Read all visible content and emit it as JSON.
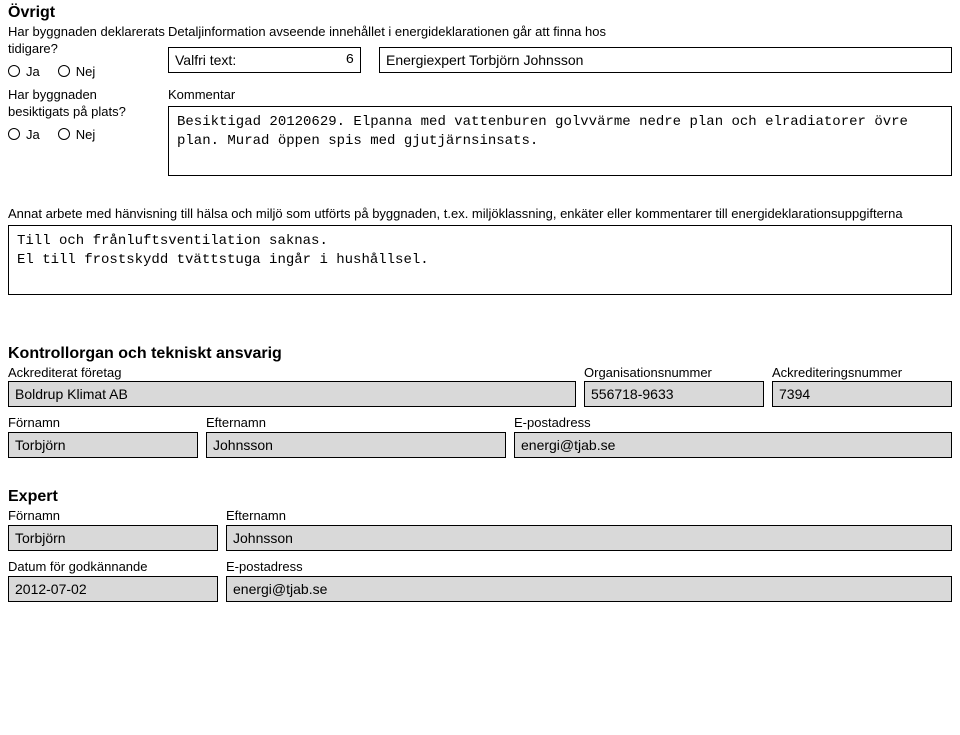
{
  "ovrigt": {
    "title": "Övrigt",
    "q1": "Har byggnaden deklarerats tidigare?",
    "q2_a": "Har byggnaden",
    "q2_b": "besiktigats på plats?",
    "ja": "Ja",
    "nej": "Nej",
    "detail_info": "Detaljinformation avseende innehållet i energideklarationen går att finna hos",
    "valfri_label": "Valfri text:",
    "valfri_num": "6",
    "valfri_value": "Energiexpert Torbjörn Johnsson",
    "kommentar_label": "Kommentar",
    "kommentar_text": "Besiktigad 20120629. Elpanna med vattenburen golvvärme nedre plan och elradiatorer övre plan. Murad öppen spis med gjutjärnsinsats."
  },
  "annat": {
    "label": "Annat arbete med hänvisning till hälsa och miljö som utförts på byggnaden, t.ex. miljöklassning, enkäter eller kommentarer till energideklarationsuppgifterna",
    "text": "Till och frånluftsventilation saknas.\nEl till frostskydd tvättstuga ingår i hushållsel."
  },
  "kontroll": {
    "title": "Kontrollorgan och tekniskt ansvarig",
    "ack_foretag_label": "Ackrediterat företag",
    "ack_foretag": "Boldrup Klimat AB",
    "orgnr_label": "Organisationsnummer",
    "orgnr": "556718-9633",
    "acknr_label": "Ackrediteringsnummer",
    "acknr": "7394",
    "fornamn_label": "Förnamn",
    "fornamn": "Torbjörn",
    "efternamn_label": "Efternamn",
    "efternamn": "Johnsson",
    "epost_label": "E-postadress",
    "epost": "energi@tjab.se"
  },
  "expert": {
    "title": "Expert",
    "fornamn_label": "Förnamn",
    "fornamn": "Torbjörn",
    "efternamn_label": "Efternamn",
    "efternamn": "Johnsson",
    "datum_label": "Datum för godkännande",
    "datum": "2012-07-02",
    "epost_label": "E-postadress",
    "epost": "energi@tjab.se"
  }
}
